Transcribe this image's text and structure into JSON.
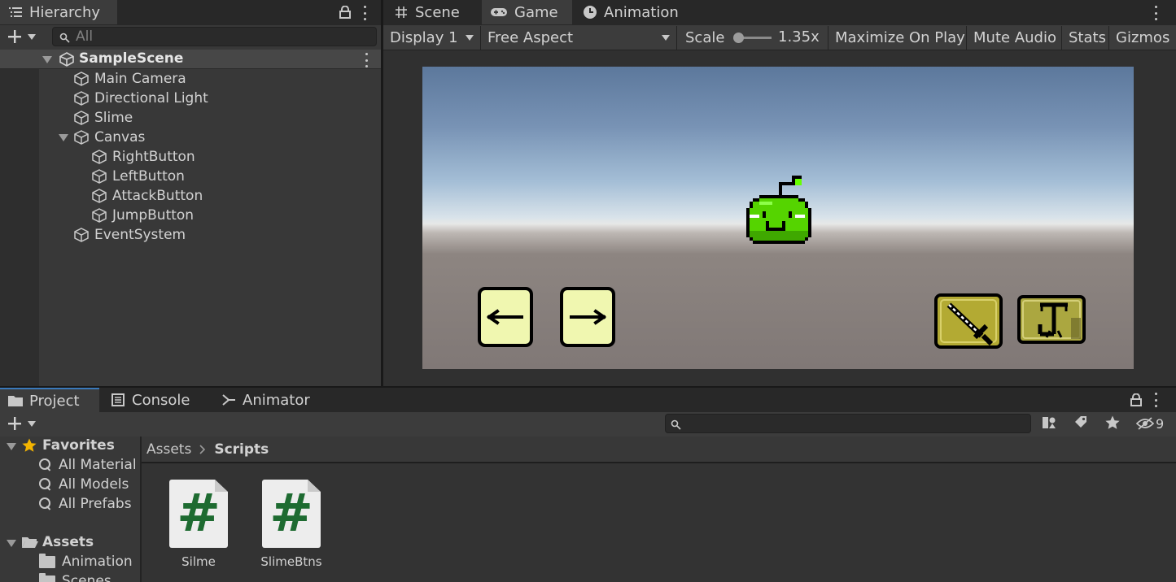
{
  "hierarchy": {
    "tab_label": "Hierarchy",
    "search_placeholder": "All",
    "scene_name": "SampleScene",
    "items": [
      {
        "label": "Main Camera"
      },
      {
        "label": "Directional Light"
      },
      {
        "label": "Slime"
      },
      {
        "label": "Canvas"
      },
      {
        "label": "RightButton"
      },
      {
        "label": "LeftButton"
      },
      {
        "label": "AttackButton"
      },
      {
        "label": "JumpButton"
      },
      {
        "label": "EventSystem"
      }
    ]
  },
  "view_tabs": {
    "scene": "Scene",
    "game": "Game",
    "animation": "Animation"
  },
  "game_toolbar": {
    "display": "Display 1",
    "aspect": "Free Aspect",
    "scale_label": "Scale",
    "scale_value": "1.35x",
    "scale_slider_fraction": 0.06,
    "maximize": "Maximize On Play",
    "mute": "Mute Audio",
    "stats": "Stats",
    "gizmos": "Gizmos"
  },
  "bottom_tabs": {
    "project": "Project",
    "console": "Console",
    "animator": "Animator"
  },
  "project": {
    "hidden_count": "9",
    "favorites_label": "Favorites",
    "favorites": [
      {
        "label": "All Material"
      },
      {
        "label": "All Models"
      },
      {
        "label": "All Prefabs"
      }
    ],
    "assets_label": "Assets",
    "asset_folders": [
      {
        "label": "Animation"
      },
      {
        "label": "Scenes"
      }
    ],
    "breadcrumb": {
      "root": "Assets",
      "current": "Scripts"
    },
    "files": [
      {
        "name": "Silme",
        "glyph": "#"
      },
      {
        "name": "SlimeBtns",
        "glyph": "#"
      }
    ]
  },
  "colors": {
    "slime_green": "#55d400",
    "button_cream": "#f0f7b0",
    "button_olive": "#b3aa33",
    "script_hash": "#1e6b31"
  }
}
